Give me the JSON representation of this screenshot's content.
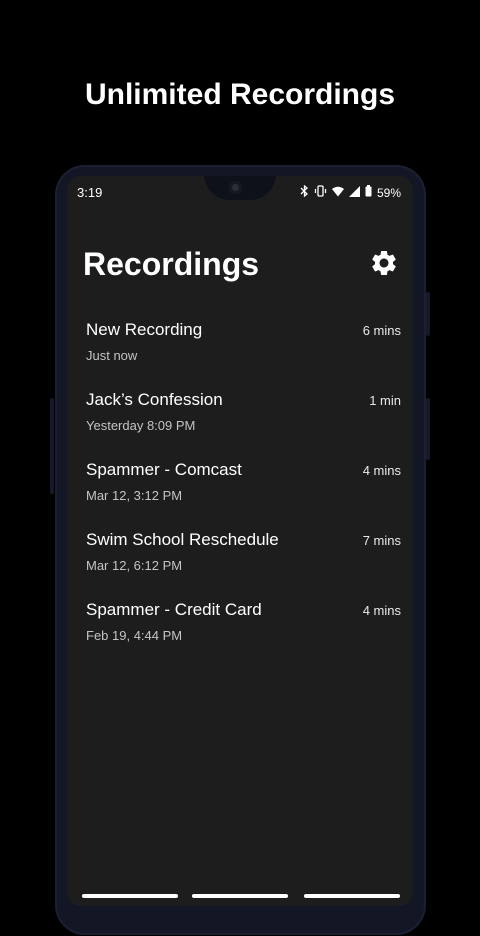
{
  "headline": "Unlimited Recordings",
  "status_bar": {
    "time": "3:19",
    "battery": "59%",
    "icons": [
      "bluetooth-icon",
      "vibrate-icon",
      "wifi-icon",
      "signal-icon",
      "battery-icon"
    ]
  },
  "app": {
    "title": "Recordings",
    "settings_icon": "gear-icon"
  },
  "recordings": [
    {
      "title": "New Recording",
      "subtitle": "Just now",
      "duration": "6 mins"
    },
    {
      "title": "Jack’s Confession",
      "subtitle": "Yesterday 8:09 PM",
      "duration": "1 min"
    },
    {
      "title": "Spammer - Comcast",
      "subtitle": "Mar 12, 3:12 PM",
      "duration": "4 mins"
    },
    {
      "title": "Swim School Reschedule",
      "subtitle": "Mar 12, 6:12 PM",
      "duration": "7 mins"
    },
    {
      "title": "Spammer - Credit Card",
      "subtitle": "Feb 19, 4:44 PM",
      "duration": "4 mins"
    }
  ],
  "colors": {
    "background": "#000000",
    "screen": "#1d1d1d",
    "text": "#ffffff",
    "subtext": "#c4c4c4"
  }
}
